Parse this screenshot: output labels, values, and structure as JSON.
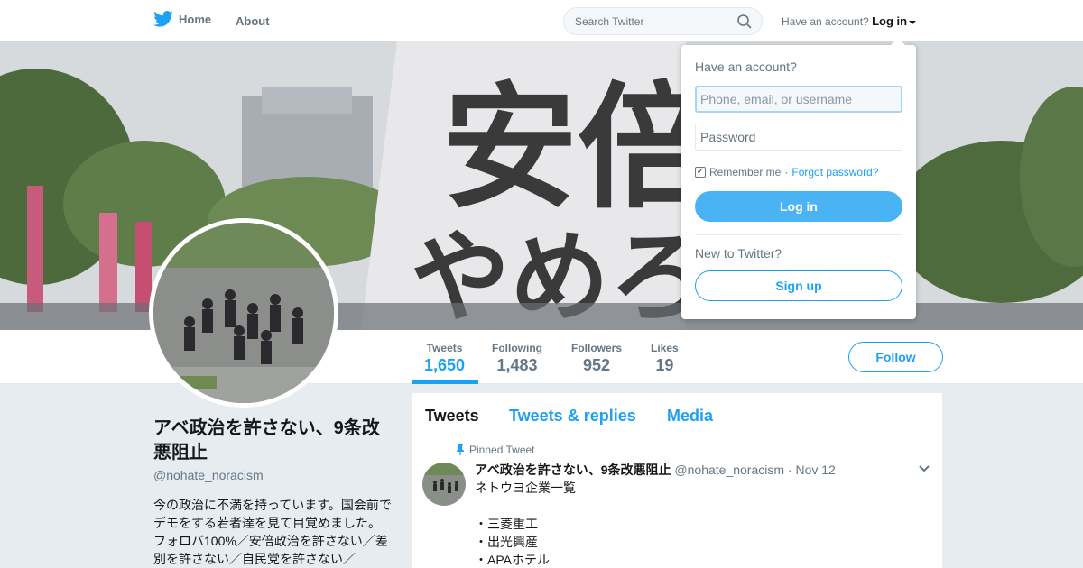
{
  "nav": {
    "home_label": "Home",
    "about_label": "About",
    "search_placeholder": "Search Twitter",
    "have_account": "Have an account?",
    "login_label": "Log in"
  },
  "banner": {
    "image_icon": "protest-banner-image",
    "sign_text_top": "安倍",
    "sign_text_bottom": "やめろ"
  },
  "profile": {
    "name": "アベ政治を許さない、9条改悪阻止",
    "handle": "@nohate_noracism",
    "bio": "今の政治に不満を持っています。国会前でデモをする若者達を見て目覚めました。フォロバ100%／安倍政治を許さない／差別を許さない／自民党を許さない／"
  },
  "stats": [
    {
      "label": "Tweets",
      "value": "1,650"
    },
    {
      "label": "Following",
      "value": "1,483"
    },
    {
      "label": "Followers",
      "value": "952"
    },
    {
      "label": "Likes",
      "value": "19"
    }
  ],
  "follow_label": "Follow",
  "timeline": {
    "tabs": [
      "Tweets",
      "Tweets & replies",
      "Media"
    ],
    "pinned_label": "Pinned Tweet",
    "tweet": {
      "fullname": "アベ政治を許さない、9条改悪阻止",
      "handle": "@nohate_noracism",
      "separator": "·",
      "date": "Nov 12",
      "lines": [
        "ネトウヨ企業一覧",
        "",
        "・三菱重工",
        "・出光興産",
        "・APAホテル"
      ]
    }
  },
  "login_dropdown": {
    "title": "Have an account?",
    "username_placeholder": "Phone, email, or username",
    "password_placeholder": "Password",
    "remember_label": "Remember me",
    "separator": "·",
    "forgot_label": "Forgot password?",
    "login_button": "Log in",
    "new_label": "New to Twitter?",
    "signup_button": "Sign up"
  },
  "colors": {
    "accent": "#1da1f2",
    "login_button": "#4ab3f4",
    "background": "#e6ecf0"
  }
}
